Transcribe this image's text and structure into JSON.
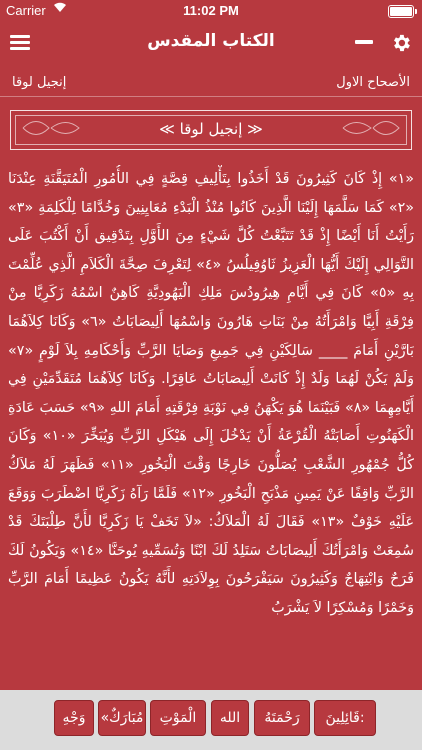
{
  "status_bar": {
    "carrier": "Carrier",
    "time": "11:02 PM"
  },
  "nav": {
    "title": "الكتاب المقدس"
  },
  "sub_header": {
    "book": "إنجيل لوقا",
    "chapter": "الأصحاح الاول"
  },
  "banner": {
    "title": "إنجيل لوقا",
    "ornament_left": "≪",
    "ornament_right": "≫"
  },
  "verses": [
    {
      "num": "«١»",
      "text": "إِذْ كَانَ كَثِيرُونَ قَدْ أَخَذُوا بِتَأْلِيفِ قِصَّةٍ فِي الأُمُورِ الْمُتَيَقَّنَةِ عِنْدَنَا"
    },
    {
      "num": "«٢»",
      "text": "كَمَا سَلَّمَهَا إِلَيْنَا الَّذِينَ كَانُوا مُنْذُ الْبَدْءِ مُعَايِنِينَ وَخُدَّامًا لِلْكَلِمَةِ"
    },
    {
      "num": "«٣»",
      "text": "رَأَيْتُ أَنَا أَيْضًا إِذْ قَدْ تَتَبَّعْتُ كُلَّ شَيْءٍ مِنَ الأَوَّلِ بِتَدْقِيق أَنْ أَكْتُبَ عَلَى التَّوَالِي إِلَيْكَ أَيُّهَا الْعَزِيزُ ثَاوُفِيلُسُ"
    },
    {
      "num": "«٤»",
      "text": "لِتَعْرِفَ صِحَّةَ الْكَلاَمِ الَّذِي عُلِّمْتَ بِهِ"
    },
    {
      "num": "«٥»",
      "text": "كَانَ فِي أَيَّامِ هِيرُودُسَ مَلِكِ الْيَهُودِيَّةِ كَاهِنٌ اسْمُهُ زَكَرِيَّا مِنْ فِرْقَةِ أَبِيَّا وَامْرَأَتُهُ مِنْ بَنَاتِ هَارُونَ وَاسْمُهَا أَلِيصَابَاتُ"
    },
    {
      "num": "«٦»",
      "text": "وَكَانَا كِلاَهُمَا بَارَّيْنِ أَمَامَ ____ سَالِكَيْنِ فِي جَمِيعِ وَصَايَا الرَّبِّ وَأَحْكَامِهِ بِلاَ لَوْمٍ"
    },
    {
      "num": "«٧»",
      "text": "وَلَمْ يَكُنْ لَهُمَا وَلَدٌ إِذْ كَانَتْ أَلِيصَابَاتُ عَاقِرًا. وَكَانَا كِلاَهُمَا مُتَقَدِّمَيْنِ فِي أَيَّامِهِمَا"
    },
    {
      "num": "«٨»",
      "text": "فَبَيْنَمَا هُوَ يَكْهَنُ فِي نَوْبَةِ فِرْقَتِهِ أَمَامَ اللهِ"
    },
    {
      "num": "«٩»",
      "text": "حَسَبَ عَادَةِ الْكَهَنُوتِ أَصَابَتْهُ الْقُرْعَةُ أَنْ يَدْخُلَ إِلَى هَيْكَلِ الرَّبِّ وَيُبَخِّرَ"
    },
    {
      "num": "«١٠»",
      "text": "وَكَانَ كُلُّ جُمْهُورِ الشَّعْبِ يُصَلُّونَ خَارِجًا وَقْتَ الْبَخُورِ"
    },
    {
      "num": "«١١»",
      "text": "فَظَهَرَ لَهُ مَلاَكُ الرَّبِّ وَاقِفًا عَنْ يَمِينِ مَذْبَحِ الْبَخُورِ"
    },
    {
      "num": "«١٢»",
      "text": "فَلَمَّا رَآهُ زَكَرِيَّا اضْطَرَبَ وَوَقَعَ عَلَيْهِ خَوْفٌ"
    },
    {
      "num": "«١٣»",
      "text": "فَقَالَ لَهُ الْمَلاَكُ: «لاَ تَخَفْ يَا زَكَرِيَّا لأَنَّ طِلْبَتَكَ قَدْ سُمِعَتْ وَامْرَأَتُكَ أَلِيصَابَاتُ سَتَلِدُ لَكَ ابْنًا وَتُسَمِّيهِ يُوحَنَّا"
    },
    {
      "num": "«١٤»",
      "text": "وَيَكُونُ لَكَ فَرَحٌ وَابْتِهَاجٌ وَكَثِيرُونَ سَيَفْرَحُونَ بِوِلاَدَتِهِ"
    },
    {
      "num": "",
      "text": "لأَنَّهُ يَكُونُ عَظِيمًا أَمَامَ الرَّبِّ وَخَمْرًا وَمُسْكِرًا لاَ يَشْرَبُ"
    }
  ],
  "word_chips": [
    "قَائِلِينَ:",
    "رَحْمَتَهُ",
    "الله",
    "الْمَوْتِ",
    "«مُبَارَكٌ",
    "وَجْهِ"
  ]
}
